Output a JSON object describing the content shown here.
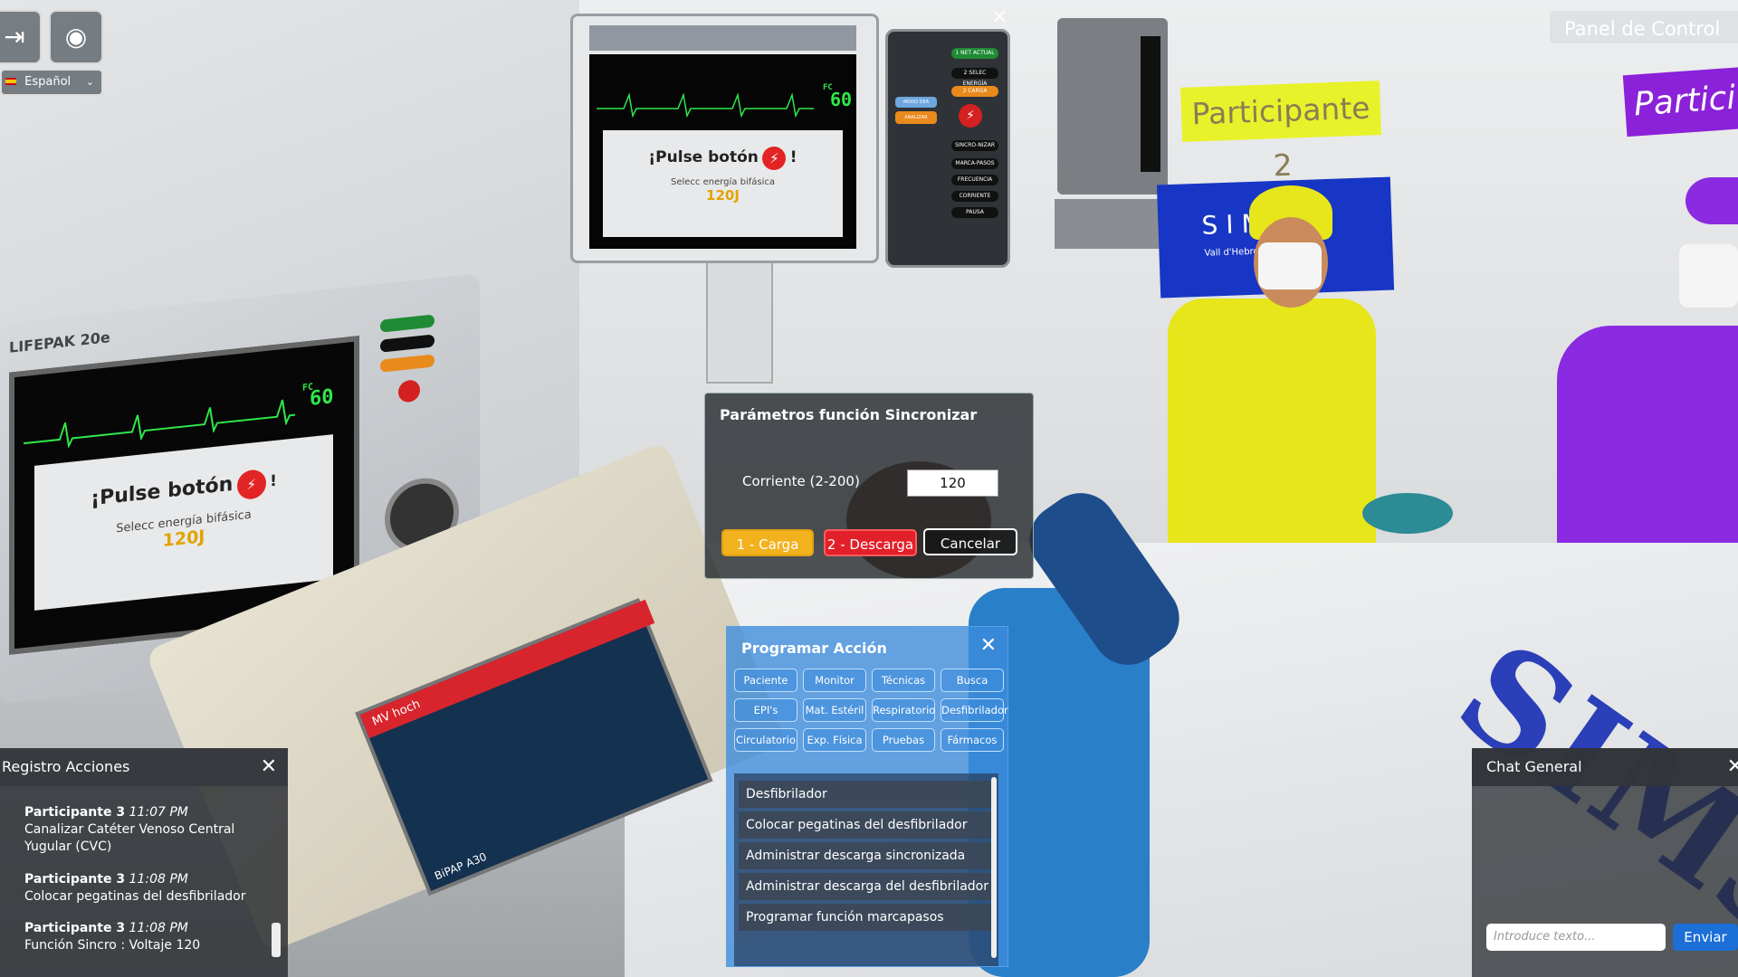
{
  "top_bar": {
    "exit_icon": "exit-door-icon",
    "webcam_icon": "webcam-icon",
    "language": "Español",
    "panel_control": "Panel de Control"
  },
  "scene": {
    "wall_monitor": {
      "fc_label": "FC",
      "fc_value": "60",
      "message": "¡Pulse botón",
      "exclaim": "!",
      "subtitle": "Selecc energía bifásica",
      "energy": "120J"
    },
    "lifepak": {
      "label": "LIFEPAK 20e",
      "fc_label": "FC",
      "fc_value": "60",
      "message": "¡Pulse botón",
      "exclaim": "!",
      "subtitle": "Selecc energía bifásica",
      "energy": "120J"
    },
    "control_panel": {
      "buttons": [
        "1 NET ACTUAL",
        "2 SELEC ENERGÍA",
        "3 CARGA",
        "SINCRO-NIZAR",
        "MARCA-PASOS",
        "FRECUENCIA",
        "CORRIENTE",
        "PAUSA"
      ],
      "side_label": "MODO DEA",
      "side_button": "ANALIZAR"
    },
    "sign_participant_2": "Participante 2",
    "sign_participant_3": "Partici",
    "banner_text": "SIM  S",
    "banner_sub": "Vall d'Hebron",
    "ventilator": {
      "model": "BiPAP A30",
      "mode": "MV hoch"
    },
    "blanket_text": "SIMS"
  },
  "sync_dialog": {
    "title": "Parámetros función Sincronizar",
    "field_label": "Corriente (2-200)",
    "field_value": "120",
    "btn_carga": "1 - Carga",
    "btn_descarga": "2 - Descarga",
    "btn_cancel": "Cancelar"
  },
  "programar": {
    "title": "Programar Acción",
    "tabs": [
      "Paciente",
      "Monitor",
      "Técnicas",
      "Busca",
      "EPI's",
      "Mat. Estéril",
      "Respiratorio",
      "Desfibrilador",
      "Circulatorio",
      "Exp. Física",
      "Pruebas",
      "Fármacos"
    ],
    "items": [
      "Desfibrilador",
      "Colocar pegatinas del desfibrilador",
      "Administrar descarga sincronizada",
      "Administrar descarga del desfibrilador",
      "Programar función marcapasos"
    ]
  },
  "registro": {
    "title": "Registro Acciones",
    "entries": [
      {
        "who": "Participante 3",
        "time": "11:07 PM",
        "text": "Canalizar Catéter Venoso Central Yugular (CVC)"
      },
      {
        "who": "Participante 3",
        "time": "11:08 PM",
        "text": "Colocar pegatinas del desfibrilador"
      },
      {
        "who": "Participante 3",
        "time": "11:08 PM",
        "text": "Función Sincro : Voltaje 120"
      }
    ]
  },
  "chat": {
    "title": "Chat General",
    "placeholder": "Introduce texto...",
    "send": "Enviar"
  }
}
